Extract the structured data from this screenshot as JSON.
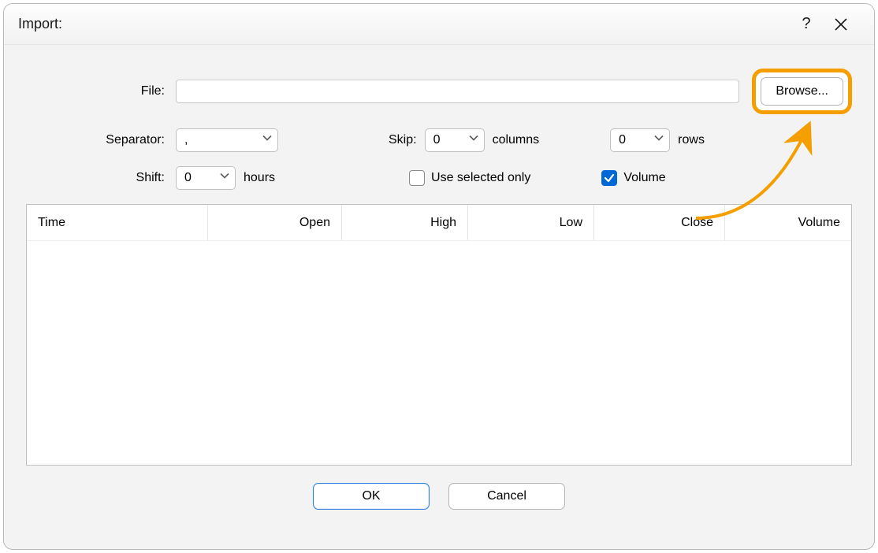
{
  "dialog": {
    "title": "Import:"
  },
  "form": {
    "file_label": "File:",
    "file_value": "",
    "browse_label": "Browse...",
    "separator_label": "Separator:",
    "separator_value": ",",
    "skip_label": "Skip:",
    "skip_cols_value": "0",
    "columns_text": "columns",
    "skip_rows_value": "0",
    "rows_text": "rows",
    "shift_label": "Shift:",
    "shift_value": "0",
    "hours_text": "hours",
    "use_selected_label": "Use selected only",
    "use_selected_checked": false,
    "volume_label": "Volume",
    "volume_checked": true
  },
  "table": {
    "columns": {
      "time": "Time",
      "open": "Open",
      "high": "High",
      "low": "Low",
      "close": "Close",
      "volume": "Volume"
    }
  },
  "buttons": {
    "ok": "OK",
    "cancel": "Cancel"
  }
}
